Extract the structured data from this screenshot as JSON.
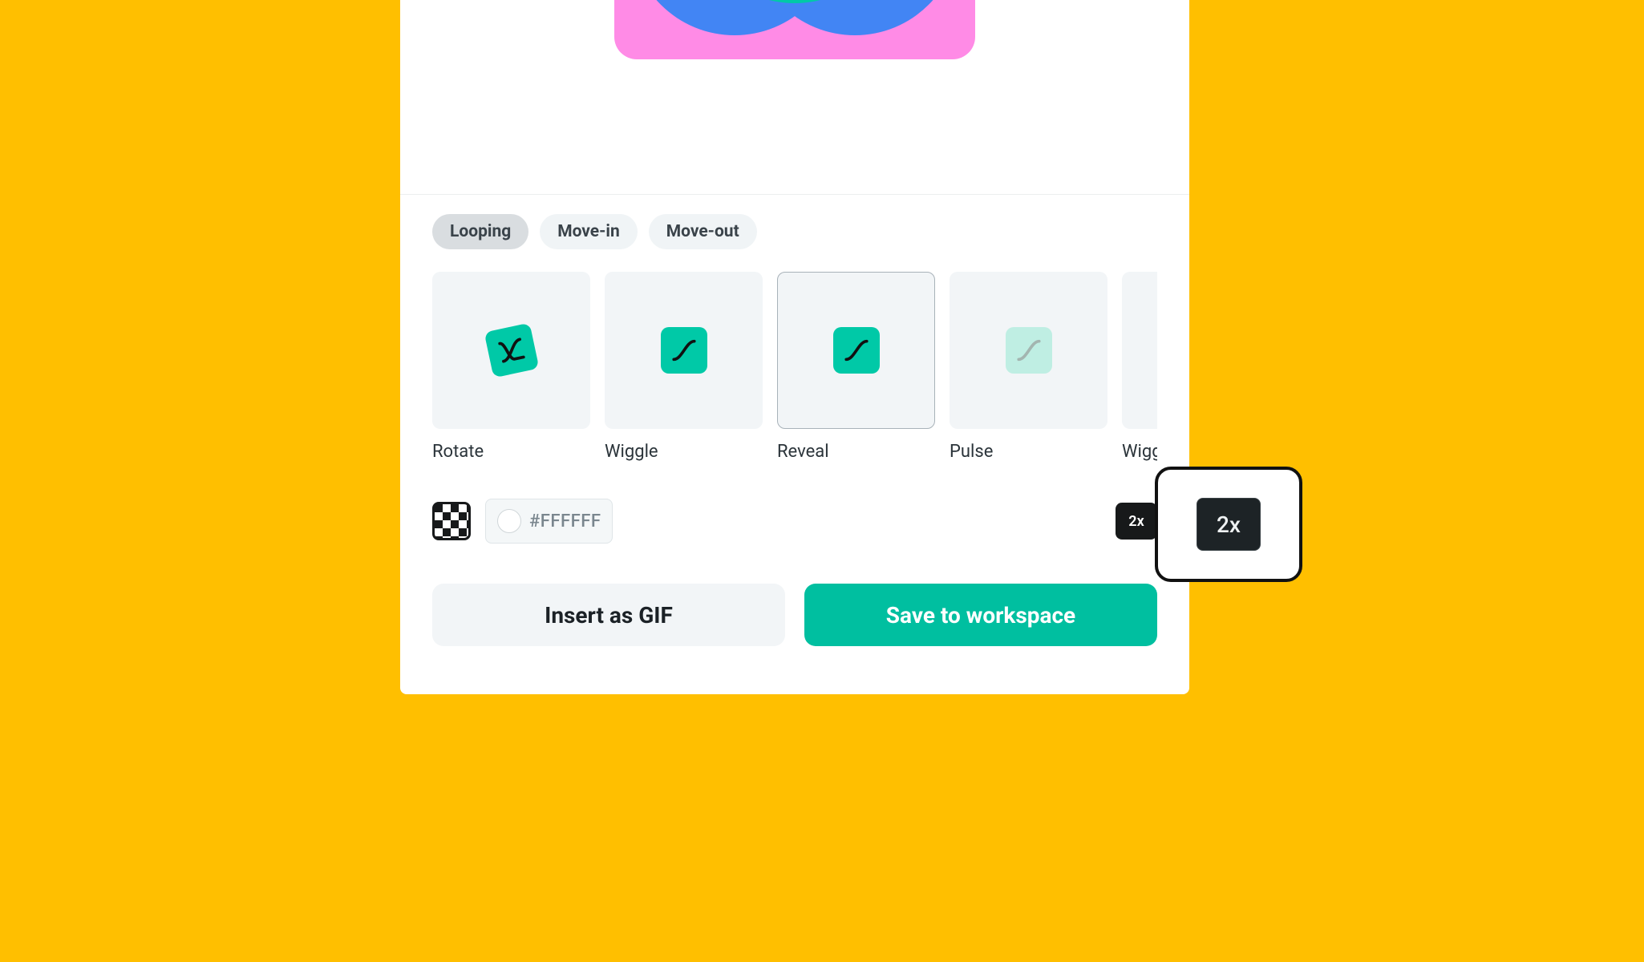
{
  "tabs": {
    "looping": "Looping",
    "movein": "Move-in",
    "moveout": "Move-out"
  },
  "animations": [
    {
      "label": "Rotate"
    },
    {
      "label": "Wiggle"
    },
    {
      "label": "Reveal"
    },
    {
      "label": "Pulse"
    },
    {
      "label": "Wiggle"
    }
  ],
  "color": {
    "hex": "#FFFFFF"
  },
  "speed": {
    "small": "2x",
    "magnified": "2x"
  },
  "buttons": {
    "insert": "Insert as GIF",
    "save": "Save to workspace"
  }
}
